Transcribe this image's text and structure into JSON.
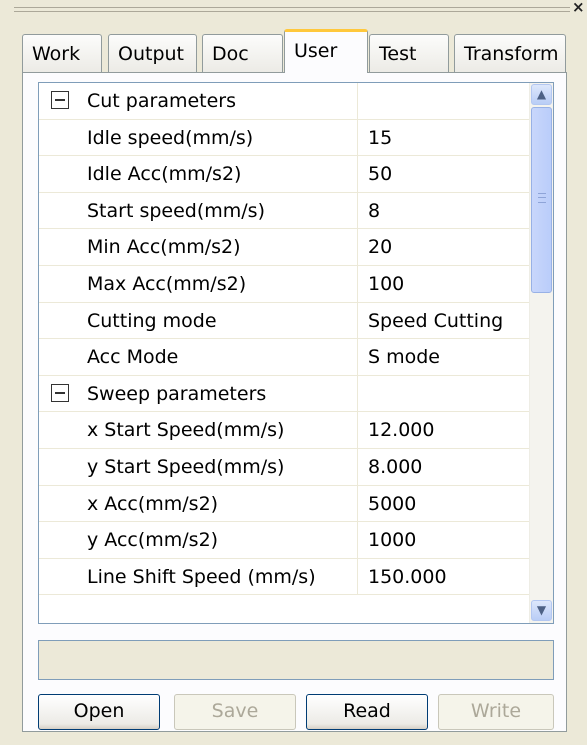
{
  "window": {
    "close_glyph": "×"
  },
  "tabs": [
    {
      "label": "Work",
      "active": false
    },
    {
      "label": "Output",
      "active": false
    },
    {
      "label": "Doc",
      "active": false
    },
    {
      "label": "User",
      "active": true
    },
    {
      "label": "Test",
      "active": false
    },
    {
      "label": "Transform",
      "active": false
    }
  ],
  "property_grid": {
    "rows": [
      {
        "kind": "category",
        "name": "Cut parameters",
        "value": ""
      },
      {
        "kind": "property",
        "name": "Idle speed(mm/s)",
        "value": "15"
      },
      {
        "kind": "property",
        "name": "Idle Acc(mm/s2)",
        "value": "50"
      },
      {
        "kind": "property",
        "name": "Start speed(mm/s)",
        "value": "8"
      },
      {
        "kind": "property",
        "name": "Min Acc(mm/s2)",
        "value": "20"
      },
      {
        "kind": "property",
        "name": "Max Acc(mm/s2)",
        "value": "100"
      },
      {
        "kind": "property",
        "name": "Cutting mode",
        "value": "Speed Cutting"
      },
      {
        "kind": "property",
        "name": "Acc Mode",
        "value": "S mode"
      },
      {
        "kind": "category",
        "name": "Sweep parameters",
        "value": ""
      },
      {
        "kind": "property",
        "name": "x Start Speed(mm/s)",
        "value": "12.000"
      },
      {
        "kind": "property",
        "name": "y Start Speed(mm/s)",
        "value": "8.000"
      },
      {
        "kind": "property",
        "name": "x Acc(mm/s2)",
        "value": "5000"
      },
      {
        "kind": "property",
        "name": "y Acc(mm/s2)",
        "value": "1000"
      },
      {
        "kind": "property",
        "name": "Line Shift Speed (mm/s)",
        "value": "150.000"
      }
    ],
    "scrollbar": {
      "up_glyph": "▲",
      "down_glyph": "▼"
    }
  },
  "status": {
    "text": ""
  },
  "buttons": [
    {
      "label": "Open",
      "enabled": true
    },
    {
      "label": "Save",
      "enabled": false
    },
    {
      "label": "Read",
      "enabled": true
    },
    {
      "label": "Write",
      "enabled": false
    }
  ],
  "colors": {
    "window_bg": "#ece9d8",
    "active_tab_accent": "#ffc83c",
    "border": "#7f9db9",
    "scrollbar_thumb": "#bacdfa"
  }
}
